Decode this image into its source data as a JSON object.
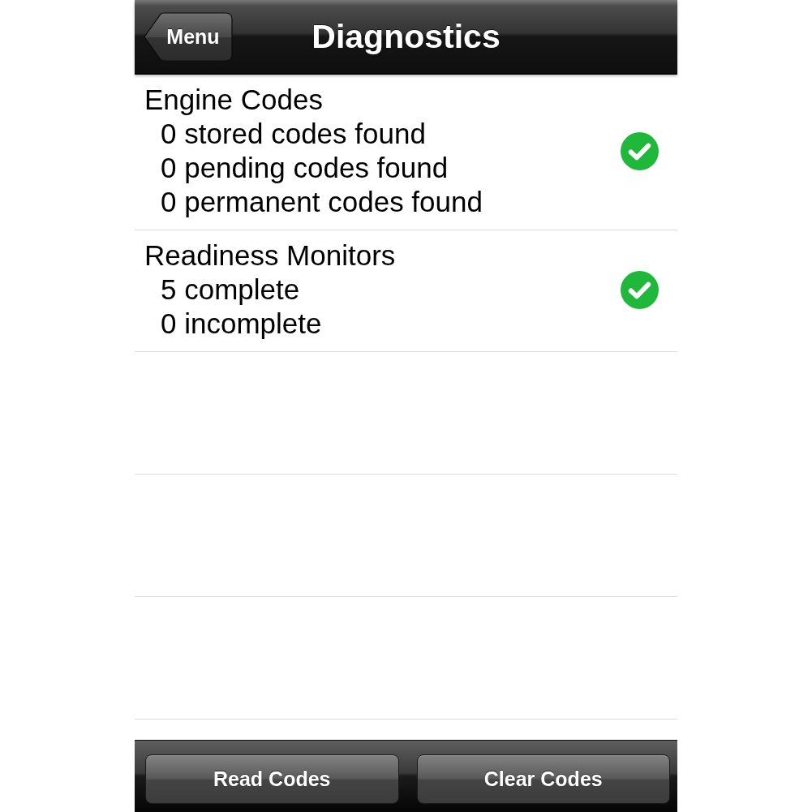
{
  "nav_bar": {
    "back_button": "Menu",
    "title": "Diagnostics"
  },
  "sections": [
    {
      "title": "Engine Codes",
      "lines": [
        "0 stored codes found",
        "0 pending codes found",
        "0 permanent codes found"
      ],
      "passed": true
    },
    {
      "title": "Readiness Monitors",
      "lines": [
        "5 complete",
        "0 incomplete"
      ],
      "passed": true
    }
  ],
  "toolbar": {
    "buttons": [
      "Read Codes",
      "Clear Codes"
    ]
  }
}
